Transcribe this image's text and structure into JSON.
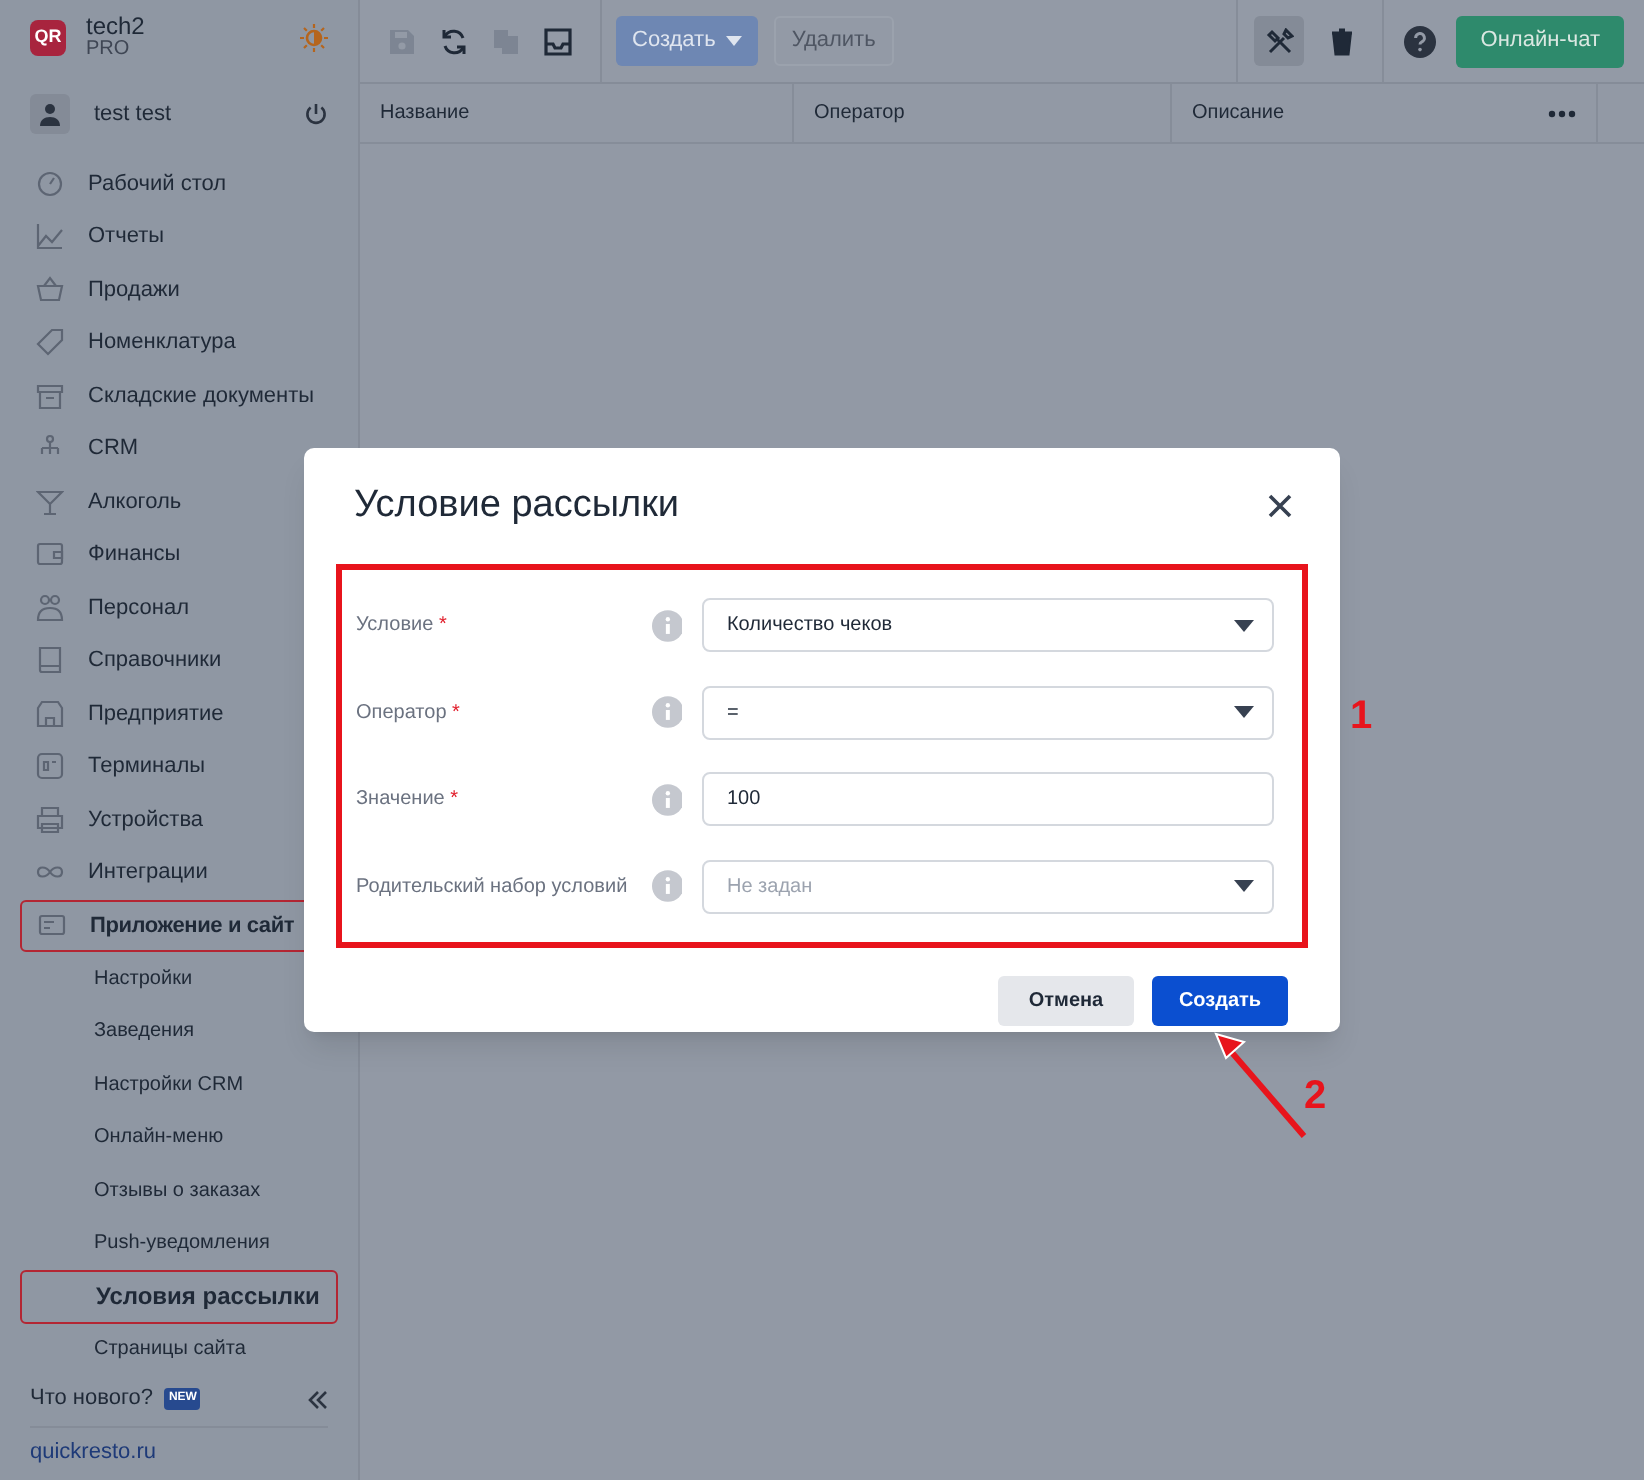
{
  "brand": {
    "logo": "QR",
    "name": "tech2",
    "plan": "PRO"
  },
  "user": {
    "name": "test test"
  },
  "sidebar": {
    "items": [
      {
        "label": "Рабочий стол",
        "highlighted": false
      },
      {
        "label": "Отчеты",
        "highlighted": false
      },
      {
        "label": "Продажи",
        "highlighted": false
      },
      {
        "label": "Номенклатура",
        "highlighted": false
      },
      {
        "label": "Складские документы",
        "highlighted": false
      },
      {
        "label": "CRM",
        "highlighted": false
      },
      {
        "label": "Алкоголь",
        "highlighted": false
      },
      {
        "label": "Финансы",
        "highlighted": false
      },
      {
        "label": "Персонал",
        "highlighted": false
      },
      {
        "label": "Справочники",
        "highlighted": false
      },
      {
        "label": "Предприятие",
        "highlighted": false
      },
      {
        "label": "Терминалы",
        "highlighted": false
      },
      {
        "label": "Устройства",
        "highlighted": false
      },
      {
        "label": "Интеграции",
        "highlighted": false
      },
      {
        "label": "Приложение и сайт",
        "highlighted": true,
        "expanded": true,
        "children": [
          {
            "label": "Настройки",
            "selected": false
          },
          {
            "label": "Заведения",
            "selected": false
          },
          {
            "label": "Настройки CRM",
            "selected": false
          },
          {
            "label": "Онлайн-меню",
            "selected": false
          },
          {
            "label": "Отзывы о заказах",
            "selected": false
          },
          {
            "label": "Push-уведомления",
            "selected": false
          },
          {
            "label": "Условия рассылки",
            "selected": true
          },
          {
            "label": "Страницы сайта",
            "selected": false
          }
        ]
      }
    ],
    "whats_new": "Что нового?",
    "new_badge": "NEW",
    "site_link": "quickresto.ru"
  },
  "toolbar": {
    "icons": [
      {
        "kind": "save",
        "disabled": true
      },
      {
        "kind": "refresh",
        "disabled": false
      },
      {
        "kind": "copy",
        "disabled": true
      },
      {
        "kind": "inbox",
        "disabled": false
      }
    ],
    "create_button": "Создать",
    "delete_button": {
      "label": "Удалить",
      "disabled": true
    },
    "right_icons": [
      {
        "kind": "tools",
        "selected": true
      },
      {
        "kind": "trash",
        "selected": false
      }
    ],
    "chat_button": "Онлайн-чат"
  },
  "table": {
    "columns": [
      "Название",
      "Оператор",
      "Описание"
    ]
  },
  "dialog": {
    "title": "Условие рассылки",
    "required_mark": "*",
    "fields": [
      {
        "label": "Условие",
        "required": true,
        "kind": "select",
        "value": "Количество чеков"
      },
      {
        "label": "Оператор",
        "required": true,
        "kind": "select",
        "value": "="
      },
      {
        "label": "Значение",
        "required": true,
        "kind": "input",
        "value": "100"
      },
      {
        "label": "Родительский набор условий",
        "required": false,
        "kind": "select",
        "placeholder": "Не задан"
      }
    ],
    "buttons": [
      {
        "label": "Отмена",
        "primary": false
      },
      {
        "label": "Создать",
        "primary": true
      }
    ]
  },
  "annotations": [
    {
      "label": "1"
    },
    {
      "label": "2"
    }
  ]
}
